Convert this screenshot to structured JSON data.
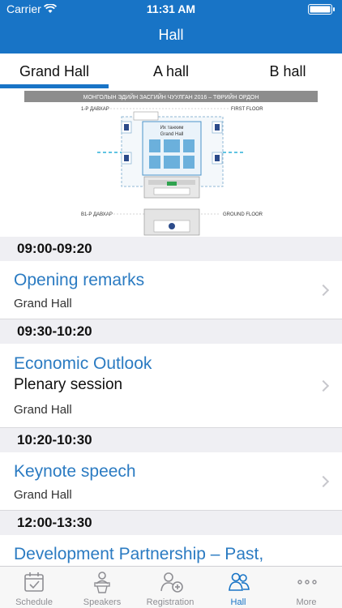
{
  "status_bar": {
    "carrier": "Carrier",
    "time": "11:31 AM"
  },
  "nav": {
    "title": "Hall"
  },
  "tabs": [
    {
      "label": "Grand Hall",
      "selected": true
    },
    {
      "label": "A hall",
      "selected": false
    },
    {
      "label": "B hall",
      "selected": false
    }
  ],
  "floor_plan": {
    "banner": "МОНГОЛЫН ЭДИЙН ЗАСГИЙН ЧУУЛГАН 2016 – ТӨРИЙН ОРДОН",
    "first_floor_mn": "1-Р ДАВХАР",
    "first_floor_en": "FIRST FLOOR",
    "hall_name_mn": "Их танхим",
    "hall_name_en": "Grand Hall",
    "ground_floor_mn": "В1-Р ДАВХАР",
    "ground_floor_en": "GROUND FLOOR"
  },
  "schedule": [
    {
      "time": "09:00-09:20",
      "title": "Opening remarks",
      "subtitle": "",
      "hall": "Grand Hall"
    },
    {
      "time": "09:30-10:20",
      "title": "Economic Outlook",
      "subtitle": "Plenary session",
      "hall": "Grand Hall"
    },
    {
      "time": "10:20-10:30",
      "title": "Keynote speech",
      "subtitle": "",
      "hall": "Grand Hall"
    },
    {
      "time": "12:00-13:30",
      "title": "Development Partnership – Past,",
      "subtitle": "",
      "hall": ""
    }
  ],
  "tab_bar": [
    {
      "label": "Schedule",
      "icon": "calendar-check-icon",
      "active": false
    },
    {
      "label": "Speakers",
      "icon": "speaker-podium-icon",
      "active": false
    },
    {
      "label": "Registration",
      "icon": "add-person-icon",
      "active": false
    },
    {
      "label": "Hall",
      "icon": "people-group-icon",
      "active": true
    },
    {
      "label": "More",
      "icon": "more-dots-icon",
      "active": false
    }
  ],
  "colors": {
    "brand_blue": "#1874c6",
    "link_blue": "#2b7bc2",
    "section_gray": "#efeff3",
    "tab_inactive": "#8e8e93"
  }
}
